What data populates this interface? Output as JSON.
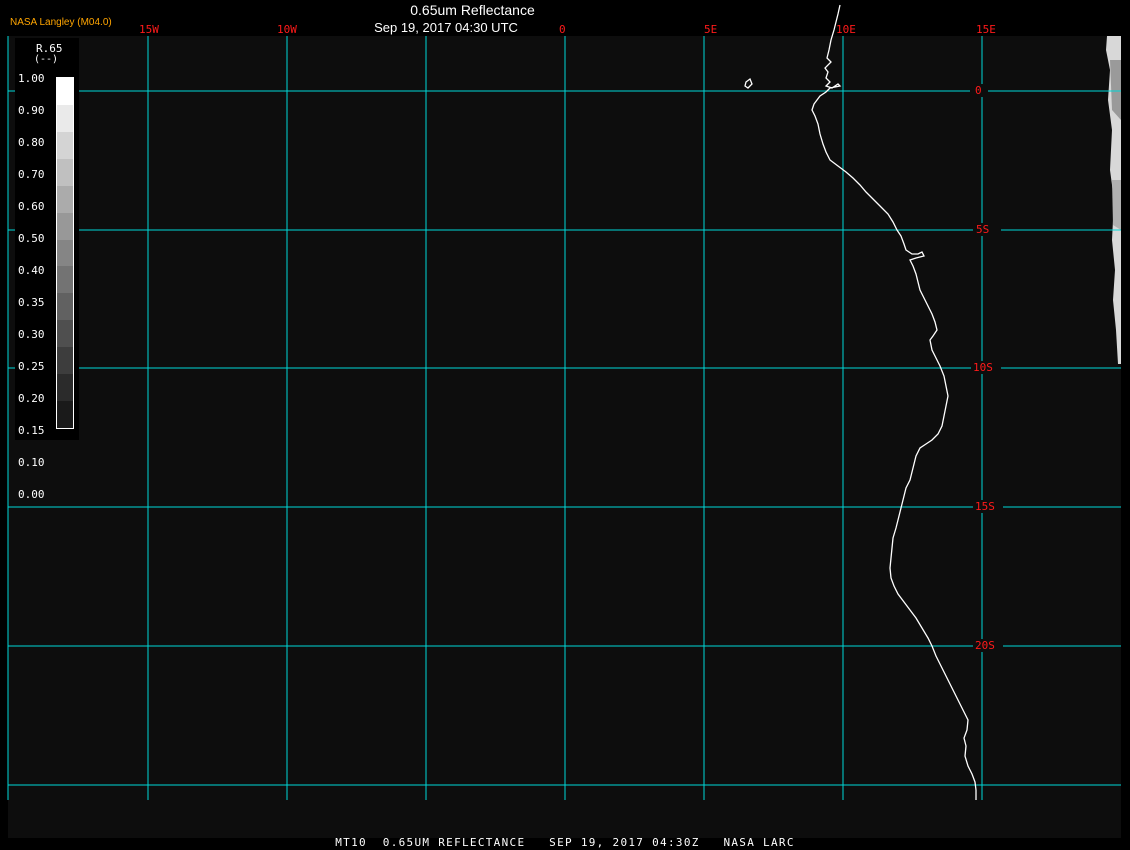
{
  "header": {
    "producer": "NASA Langley (M04.0)",
    "title": "0.65um Reflectance",
    "datetime": "Sep 19, 2017 04:30 UTC"
  },
  "legend": {
    "title": "R.65",
    "unit": "(--)",
    "ticks": [
      "1.00",
      "0.90",
      "0.80",
      "0.70",
      "0.60",
      "0.50",
      "0.40",
      "0.35",
      "0.30",
      "0.25",
      "0.20",
      "0.15",
      "0.10",
      "0.00"
    ],
    "colors": [
      "#ffffff",
      "#eaeaea",
      "#d4d4d4",
      "#c0c0c0",
      "#ababab",
      "#989898",
      "#858585",
      "#737373",
      "#616161",
      "#4f4f4f",
      "#3d3d3d",
      "#2b2b2b",
      "#1a1a1a"
    ]
  },
  "map": {
    "longitude_labels": [
      "15W",
      "10W",
      "0",
      "5E",
      "10E",
      "15E"
    ],
    "latitude_labels": [
      "0",
      "5S",
      "10S",
      "15S",
      "20S"
    ],
    "grid_color": "#00d7d7",
    "label_color": "#ff1a1a",
    "coastline_color": "#ffffff",
    "background": "#0d0d0d"
  },
  "footer": {
    "caption": "MT10  0.65UM REFLECTANCE   SEP 19, 2017 04:30Z   NASA LARC"
  }
}
